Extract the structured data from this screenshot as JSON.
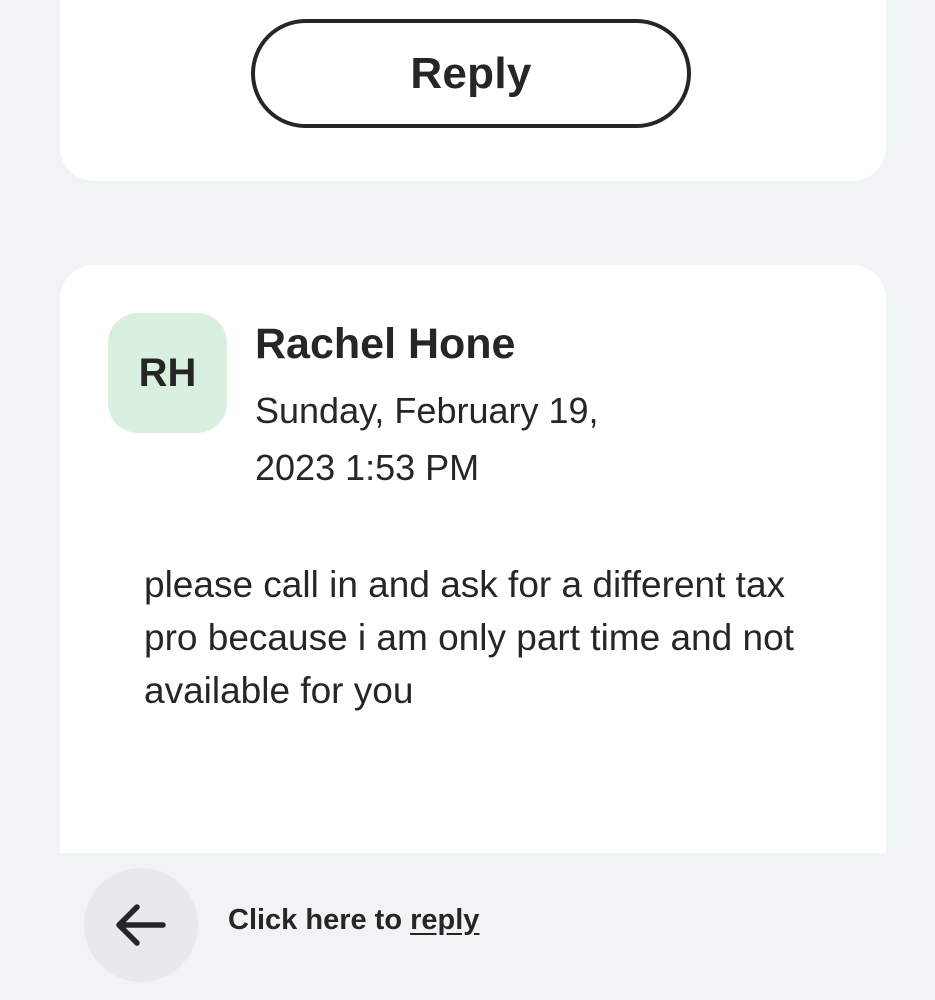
{
  "reply_card": {
    "reply_button_label": "Reply"
  },
  "message": {
    "avatar_initials": "RH",
    "sender_name": "Rachel Hone",
    "timestamp": "Sunday, February 19, 2023 1:53 PM",
    "body": "please call in and ask for a different tax pro because i am only part time and not available for you"
  },
  "footer": {
    "back_icon": "arrow-left-icon",
    "prompt_text": "Click here to ",
    "reply_link_text": "reply"
  },
  "colors": {
    "background": "#f1f4f5",
    "card": "#ffffff",
    "avatar_bg": "#d9efdf",
    "back_button_bg": "#e6eaed",
    "text": "#262626"
  }
}
